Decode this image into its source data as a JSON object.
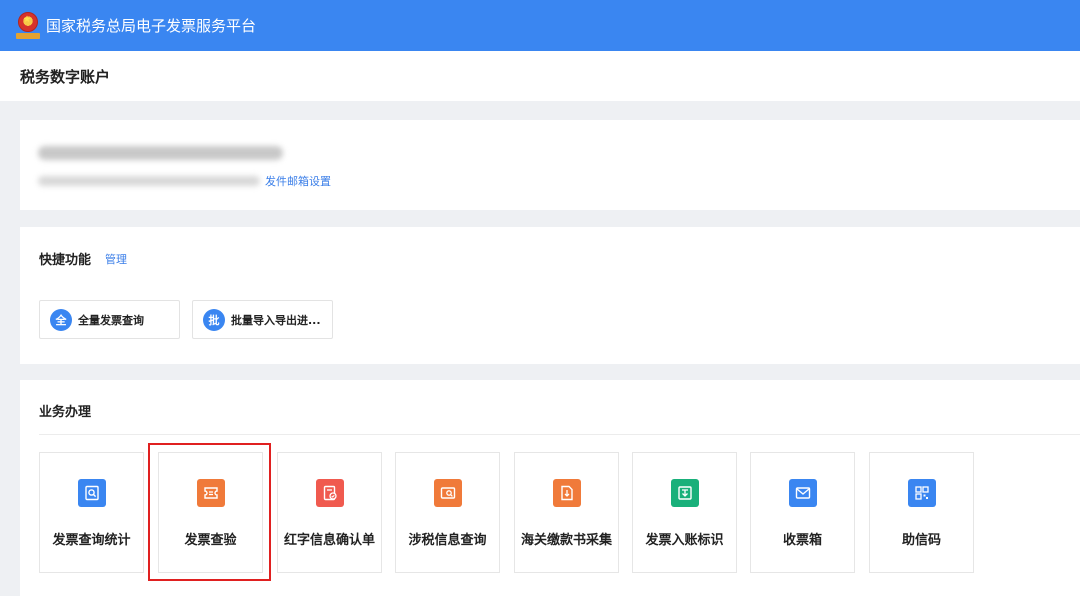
{
  "topbar": {
    "title": "国家税务总局电子发票服务平台",
    "emblem_icon": "national-tax-emblem"
  },
  "page": {
    "title": "税务数字账户"
  },
  "user_card": {
    "email_settings_link": "发件邮箱设置"
  },
  "quick": {
    "title": "快捷功能",
    "manage_link": "管理",
    "items": [
      {
        "badge": "全",
        "label": "全量发票查询"
      },
      {
        "badge": "批",
        "label": "批量导入导出进..."
      }
    ]
  },
  "business": {
    "title": "业务办理",
    "tiles": [
      {
        "label": "发票查询统计",
        "icon": "invoice-search-icon",
        "color": "#3a86f1"
      },
      {
        "label": "发票查验",
        "icon": "invoice-verify-icon",
        "color": "#f07a3a"
      },
      {
        "label": "红字信息确认单",
        "icon": "red-letter-confirm-icon",
        "color": "#f05a4f"
      },
      {
        "label": "涉税信息查询",
        "icon": "tax-info-query-icon",
        "color": "#f07a3a"
      },
      {
        "label": "海关缴款书采集",
        "icon": "customs-payment-icon",
        "color": "#f07a3a"
      },
      {
        "label": "发票入账标识",
        "icon": "invoice-posting-icon",
        "color": "#19b07a"
      },
      {
        "label": "收票箱",
        "icon": "inbox-envelope-icon",
        "color": "#3a86f1"
      },
      {
        "label": "助信码",
        "icon": "qr-code-icon",
        "color": "#3a86f1"
      }
    ]
  },
  "colors": {
    "topbar": "#3a86f1",
    "highlight": "#e02020",
    "link": "#3a7ee8"
  }
}
